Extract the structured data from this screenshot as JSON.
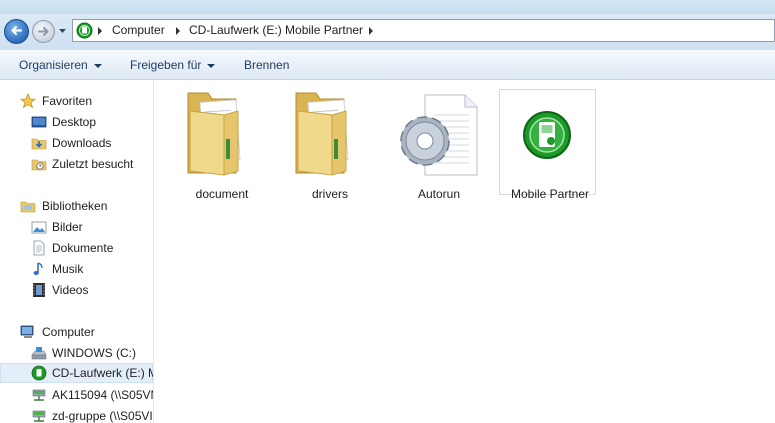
{
  "address": {
    "crumbs": [
      "Computer",
      "CD-Laufwerk (E:) Mobile Partner"
    ]
  },
  "toolbar": {
    "organize": "Organisieren",
    "share": "Freigeben für",
    "burn": "Brennen"
  },
  "sidebar": {
    "favorites": {
      "header": "Favoriten",
      "items": [
        "Desktop",
        "Downloads",
        "Zuletzt besucht"
      ]
    },
    "libraries": {
      "header": "Bibliotheken",
      "items": [
        "Bilder",
        "Dokumente",
        "Musik",
        "Videos"
      ]
    },
    "computer": {
      "header": "Computer",
      "items": [
        "WINDOWS (C:)",
        "CD-Laufwerk (E:) M",
        "AK115094 (\\\\S05VM",
        "zd-gruppe (\\\\S05VI"
      ]
    }
  },
  "files": [
    {
      "name": "document",
      "icon": "folder-icon"
    },
    {
      "name": "drivers",
      "icon": "folder-icon"
    },
    {
      "name": "Autorun",
      "icon": "settings-file-icon"
    },
    {
      "name": "Mobile Partner",
      "icon": "mobile-partner-app-icon"
    }
  ],
  "colors": {
    "accent": "#2a6bbd",
    "selection": "#e3eef9",
    "folder": "#e8c96a",
    "app_green": "#1e9a2a"
  }
}
